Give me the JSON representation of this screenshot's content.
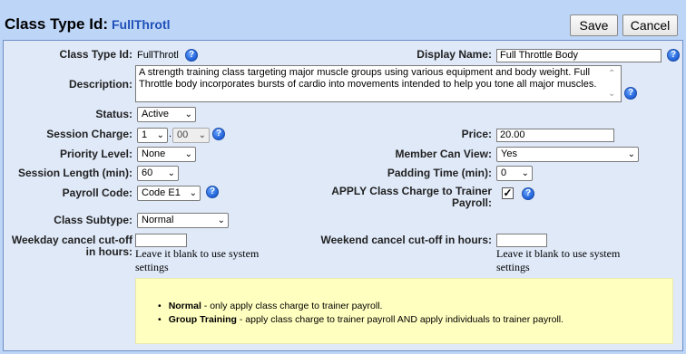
{
  "header": {
    "title": "Class Type Id:",
    "class_id": "FullThrotl",
    "save_label": "Save",
    "cancel_label": "Cancel"
  },
  "form": {
    "class_type_id": {
      "label": "Class Type Id:",
      "value": "FullThrotl"
    },
    "display_name": {
      "label": "Display Name:",
      "value": "Full Throttle Body"
    },
    "description": {
      "label": "Description:",
      "value": "A strength training class targeting major muscle groups using various equipment and body weight. Full Throttle body incorporates bursts of cardio into movements intended to help you tone all major muscles."
    },
    "status": {
      "label": "Status:",
      "value": "Active"
    },
    "session_charge": {
      "label": "Session Charge:",
      "dollars": "1",
      "sep": ".",
      "cents": "00"
    },
    "price": {
      "label": "Price:",
      "value": "20.00"
    },
    "priority_level": {
      "label": "Priority Level:",
      "value": "None"
    },
    "member_can_view": {
      "label": "Member Can View:",
      "value": "Yes"
    },
    "session_length": {
      "label": "Session Length (min):",
      "value": "60"
    },
    "padding_time": {
      "label": "Padding Time (min):",
      "value": "0"
    },
    "payroll_code": {
      "label": "Payroll Code:",
      "value": "Code E1"
    },
    "apply_class_charge": {
      "label_line1": "APPLY Class Charge to Trainer",
      "label_line2": "Payroll:",
      "checked": true,
      "check_mark": "✓"
    },
    "class_subtype": {
      "label": "Class Subtype:",
      "value": "Normal"
    },
    "weekday_cutoff": {
      "label_line1": "Weekday cancel cut-off",
      "label_line2": "in hours:",
      "value": "",
      "hint_line1": "Leave it blank to use system",
      "hint_line2": "settings"
    },
    "weekend_cutoff": {
      "label": "Weekend cancel cut-off in hours:",
      "value": "",
      "hint_line1": "Leave it blank to use system",
      "hint_line2": "settings"
    }
  },
  "info": {
    "items": [
      {
        "bold": "Normal",
        "text": " - only apply class charge to trainer payroll."
      },
      {
        "bold": "Group Training",
        "text": " - apply class charge to trainer payroll AND apply individuals to trainer payroll."
      }
    ]
  },
  "icons": {
    "help": "?",
    "chevron": "⌄",
    "scroll_up": "⌃",
    "scroll_down": "⌄"
  }
}
